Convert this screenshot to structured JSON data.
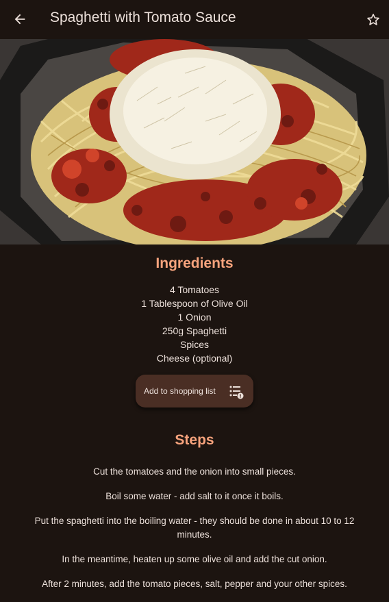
{
  "appbar": {
    "title": "Spaghetti with Tomato Sauce",
    "back_icon": "arrow-left-icon",
    "favorite_icon": "star-outline-icon"
  },
  "ingredients": {
    "title": "Ingredients",
    "items": [
      "4 Tomatoes",
      "1 Tablespoon of Olive Oil",
      "1 Onion",
      "250g Spaghetti",
      "Spices",
      "Cheese (optional)"
    ],
    "shopping_button_label": "Add to shopping list",
    "shopping_button_icon": "playlist-add-icon"
  },
  "steps": {
    "title": "Steps",
    "items": [
      "Cut the tomatoes and the onion into small pieces.",
      "Boil some water - add salt to it once it boils.",
      "Put the spaghetti into the boiling water - they should be done in about 10 to 12 minutes.",
      "In the meantime, heaten up some olive oil and add the cut onion.",
      "After 2 minutes, add the tomato pieces, salt, pepper and your other spices."
    ]
  },
  "colors": {
    "background": "#1c1410",
    "accent": "#f7a37d",
    "button_bg": "#4a2e24",
    "text": "#ece0da"
  }
}
